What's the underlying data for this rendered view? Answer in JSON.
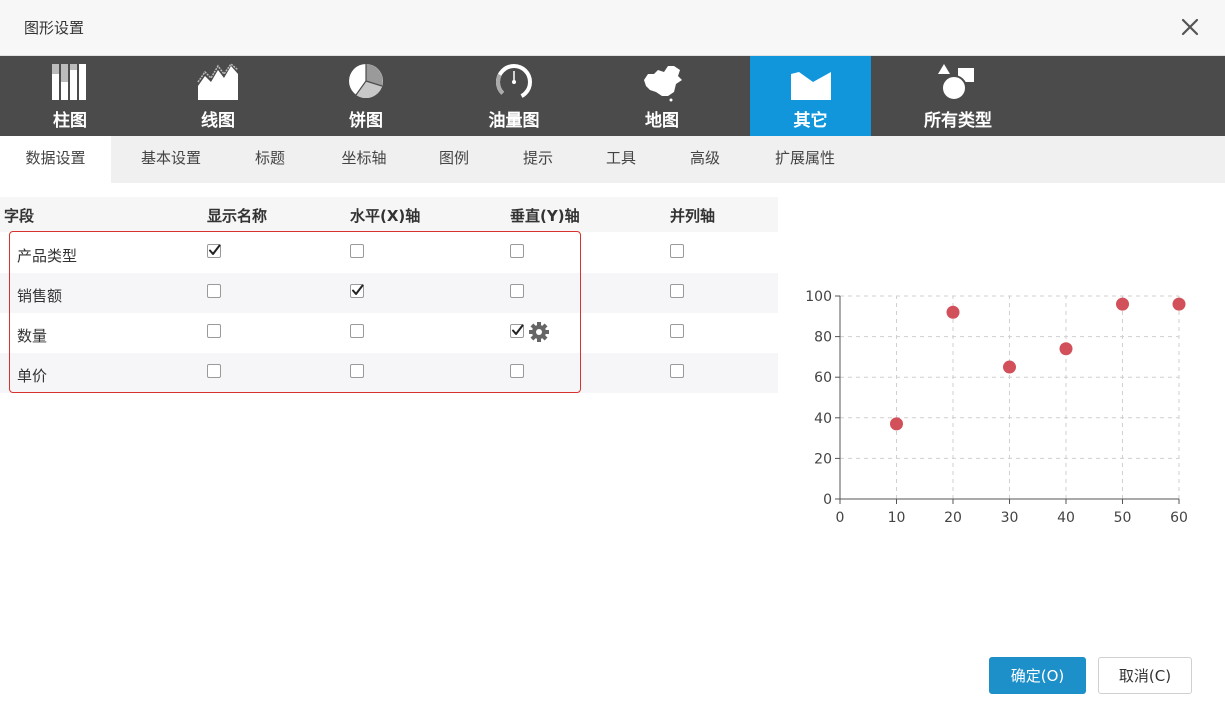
{
  "dialog": {
    "title": "图形设置"
  },
  "chart_types": [
    {
      "label": "柱图",
      "icon": "bar-chart-icon",
      "active": false
    },
    {
      "label": "线图",
      "icon": "line-chart-icon",
      "active": false
    },
    {
      "label": "饼图",
      "icon": "pie-chart-icon",
      "active": false
    },
    {
      "label": "油量图",
      "icon": "gauge-icon",
      "active": false
    },
    {
      "label": "地图",
      "icon": "china-map-icon",
      "active": false
    },
    {
      "label": "其它",
      "icon": "other-chart-icon",
      "active": true
    },
    {
      "label": "所有类型",
      "icon": "shapes-icon",
      "active": false
    }
  ],
  "tabs": [
    "数据设置",
    "基本设置",
    "标题",
    "坐标轴",
    "图例",
    "提示",
    "工具",
    "高级",
    "扩展属性"
  ],
  "active_tab": "数据设置",
  "table": {
    "headers": [
      "字段",
      "显示名称",
      "水平(X)轴",
      "垂直(Y)轴",
      "并列轴"
    ],
    "rows": [
      {
        "field": "产品类型",
        "display_name": true,
        "x_axis": false,
        "y_axis": false,
        "parallel_axis": false
      },
      {
        "field": "销售额",
        "display_name": false,
        "x_axis": true,
        "y_axis": false,
        "parallel_axis": false
      },
      {
        "field": "数量",
        "display_name": false,
        "x_axis": false,
        "y_axis": true,
        "parallel_axis": false
      },
      {
        "field": "单价",
        "display_name": false,
        "x_axis": false,
        "y_axis": false,
        "parallel_axis": false
      }
    ]
  },
  "chart_data": {
    "type": "scatter",
    "x": [
      10,
      20,
      30,
      40,
      50,
      60
    ],
    "y": [
      37,
      92,
      65,
      74,
      96,
      96
    ],
    "xlim": [
      0,
      60
    ],
    "ylim": [
      0,
      100
    ],
    "xticks": [
      0,
      10,
      20,
      30,
      40,
      50,
      60
    ],
    "yticks": [
      0,
      20,
      40,
      60,
      80,
      100
    ],
    "grid": true,
    "point_color": "#d1505a"
  },
  "buttons": {
    "ok": "确定(O)",
    "cancel": "取消(C)"
  },
  "colors": {
    "accent": "#1296db",
    "toolbar_bg": "#4b4b4b",
    "highlight_border": "#d9322e"
  }
}
